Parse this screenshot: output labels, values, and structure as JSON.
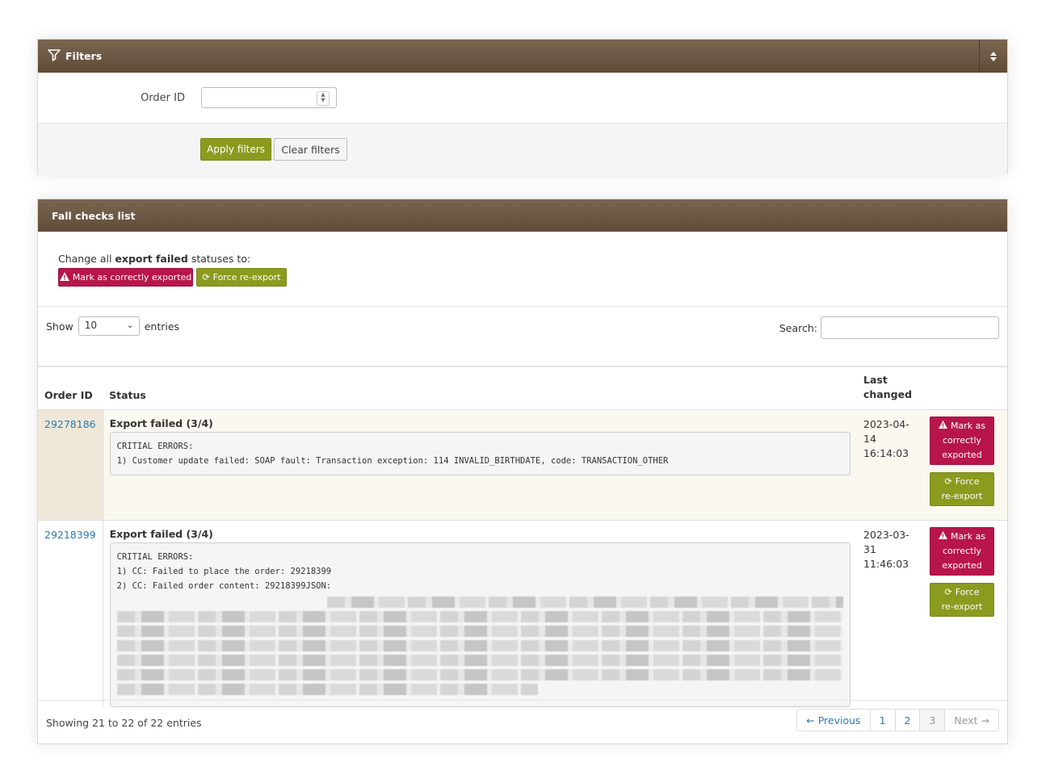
{
  "filters": {
    "title": "Filters",
    "order_id_label": "Order ID",
    "order_id_value": "",
    "apply_label": "Apply filters",
    "clear_label": "Clear filters"
  },
  "list": {
    "title": "Fall checks list",
    "bulk_prefix": "Change all ",
    "bulk_bold": "export failed",
    "bulk_suffix": " statuses to:",
    "mark_all_label": "Mark as correctly exported",
    "force_all_label": "Force re-export",
    "show_label": "Show",
    "entries_value": "10",
    "entries_label": "entries",
    "search_label": "Search:",
    "search_value": "",
    "columns": {
      "order_id": "Order ID",
      "status": "Status",
      "last_changed": "Last changed"
    },
    "rows": [
      {
        "order_id": "29278186",
        "status_title": "Export failed (3/4)",
        "errors": "CRITIAL ERRORS:\n1) Customer update failed: SOAP fault: Transaction exception: 114 INVALID_BIRTHDATE, code: TRANSACTION_OTHER",
        "date": "2023-04-14",
        "time": "16:14:03",
        "mark_label_1": "Mark as",
        "mark_label_2": "correctly",
        "mark_label_3": "exported",
        "force_label_1": "Force",
        "force_label_2": "re-export"
      },
      {
        "order_id": "29218399",
        "status_title": "Export failed (3/4)",
        "errors": "CRITIAL ERRORS:\n1) CC: Failed to place the order: 29218399\n2) CC: Failed order content: 29218399JSON:",
        "date": "2023-03-31",
        "time": "11:46:03",
        "mark_label_1": "Mark as",
        "mark_label_2": "correctly",
        "mark_label_3": "exported",
        "force_label_1": "Force",
        "force_label_2": "re-export"
      }
    ],
    "showing": "Showing 21 to 22 of 22 entries",
    "pager": {
      "prev": "← Previous",
      "p1": "1",
      "p2": "2",
      "p3": "3",
      "next": "Next →"
    }
  }
}
